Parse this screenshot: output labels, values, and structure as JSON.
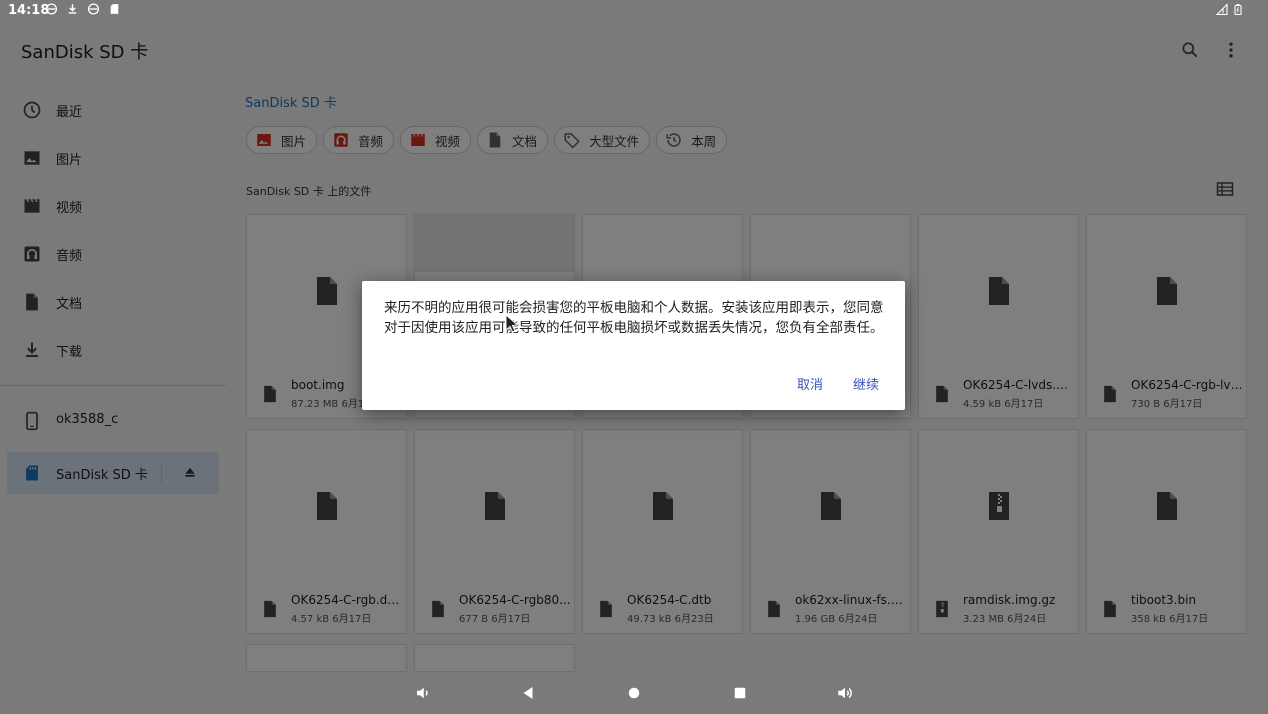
{
  "status_bar": {
    "time": "14:18",
    "left_icons": [
      "sim-icon",
      "download-icon",
      "sim-icon",
      "sd-card-icon"
    ],
    "right_icons": [
      "signal-icon",
      "battery-icon"
    ]
  },
  "app_bar": {
    "title": "SanDisk SD 卡",
    "actions": [
      "search-icon",
      "more-vert-icon"
    ]
  },
  "drawer": {
    "items": [
      {
        "label": "最近",
        "icon": "clock-icon"
      },
      {
        "label": "图片",
        "icon": "image-icon"
      },
      {
        "label": "视频",
        "icon": "video-icon"
      },
      {
        "label": "音频",
        "icon": "audio-icon"
      },
      {
        "label": "文档",
        "icon": "document-icon"
      },
      {
        "label": "下载",
        "icon": "download-icon"
      }
    ],
    "devices": [
      {
        "label": "ok3588_c",
        "icon": "phone-icon"
      },
      {
        "label": "SanDisk SD 卡",
        "icon": "sd-card-icon",
        "selected": true,
        "action": "eject-icon"
      }
    ]
  },
  "main": {
    "breadcrumb": "SanDisk SD 卡",
    "chips": [
      {
        "label": "图片",
        "icon": "image-icon",
        "color": "#d93025"
      },
      {
        "label": "音频",
        "icon": "audio-icon",
        "color": "#d93025"
      },
      {
        "label": "视频",
        "icon": "video-icon",
        "color": "#d93025"
      },
      {
        "label": "文档",
        "icon": "document-icon",
        "color": "#5f6368"
      },
      {
        "label": "大型文件",
        "icon": "tag-icon",
        "color": "#5f6368"
      },
      {
        "label": "本周",
        "icon": "history-icon",
        "color": "#5f6368"
      }
    ],
    "section_label": "SanDisk SD 卡 上的文件",
    "view_toggle_icon": "list-view-icon",
    "files_row1": [
      {
        "name": "boot.img",
        "meta": "87.23 MB 6月17日",
        "icon": "file-icon"
      },
      {
        "name": "",
        "meta": "",
        "icon": "file-icon"
      },
      {
        "name": "",
        "meta": "",
        "icon": "file-icon"
      },
      {
        "name": "",
        "meta": "",
        "icon": "file-icon"
      },
      {
        "name": "OK6254-C-lvds.dt...",
        "meta": "4.59 kB 6月17日",
        "icon": "file-icon"
      },
      {
        "name": "OK6254-C-rgb-lvd...",
        "meta": "730 B 6月17日",
        "icon": "file-icon"
      }
    ],
    "files_row2": [
      {
        "name": "OK6254-C-rgb.dt...",
        "meta": "4.57 kB 6月17日",
        "icon": "file-icon"
      },
      {
        "name": "OK6254-C-rgb80...",
        "meta": "677 B 6月17日",
        "icon": "file-icon"
      },
      {
        "name": "OK6254-C.dtb",
        "meta": "49.73 kB 6月23日",
        "icon": "file-icon"
      },
      {
        "name": "ok62xx-linux-fs.s...",
        "meta": "1.96 GB 6月24日",
        "icon": "file-icon"
      },
      {
        "name": "ramdisk.img.gz",
        "meta": "3.23 MB 6月24日",
        "icon": "archive-icon"
      },
      {
        "name": "tiboot3.bin",
        "meta": "358 kB 6月17日",
        "icon": "file-icon"
      }
    ]
  },
  "dialog": {
    "message": "来历不明的应用很可能会损害您的平板电脑和个人数据。安装该应用即表示，您同意对于因使用该应用可能导致的任何平板电脑损坏或数据丢失情况，您负有全部责任。",
    "cancel_label": "取消",
    "continue_label": "继续",
    "accent": "#3f51b5"
  },
  "nav_bar": {
    "icons": [
      "volume-down-icon",
      "back-icon",
      "home-icon",
      "recents-icon",
      "volume-up-icon"
    ]
  }
}
